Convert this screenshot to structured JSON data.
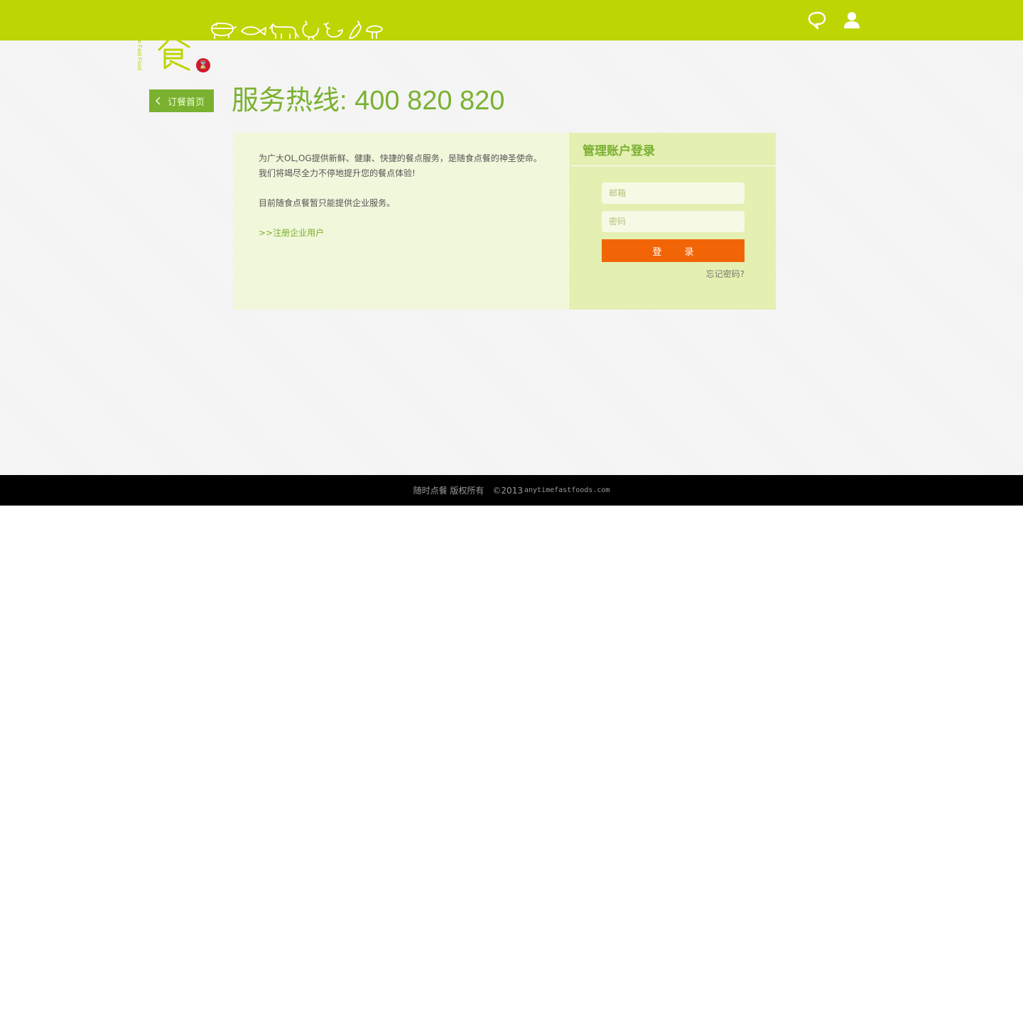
{
  "brand": {
    "logo_char": "随食",
    "logo_latin": "Anytime Fast Food",
    "badge_glyph": "⌛",
    "topbar_color": "#bdd502",
    "accent_green": "#7ab130"
  },
  "header": {
    "icons": [
      "pig-icon",
      "fish-icon",
      "cow-icon",
      "chicken-icon",
      "duck-icon",
      "eggplant-icon",
      "mushroom-icon",
      "chat-bubble-icon",
      "user-icon"
    ]
  },
  "nav": {
    "back_label": "订餐首页"
  },
  "hotline": {
    "text": "服务热线: 400 820 820"
  },
  "intro": {
    "line1": "为广大OL,OG提供新鲜、健康、快捷的餐点服务，是随食点餐的神圣使命。",
    "line2": "我们将竭尽全力不停地提升您的餐点体验!",
    "line3": "目前随食点餐暂只能提供企业服务。",
    "register_link": ">>注册企业用户"
  },
  "login": {
    "title": "管理账户登录",
    "email_placeholder": "邮箱",
    "password_placeholder": "密码",
    "submit_label": "登 录",
    "forgot_label": "忘记密码?",
    "button_color": "#f26507"
  },
  "footer": {
    "copyright": "随时点餐 版权所有",
    "year": "©2013",
    "domain": "anytimefastfoods.com"
  }
}
